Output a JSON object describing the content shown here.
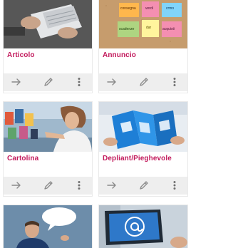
{
  "accent": "#c2185b",
  "cards": [
    {
      "title": "Articolo",
      "image": "hands-holding-newspaper-photo"
    },
    {
      "title": "Annuncio",
      "image": "sticky-notes-board-photo",
      "notes": [
        "consegna",
        "verdi",
        "crmo",
        "scadenze",
        "acquisti",
        "dar"
      ]
    },
    {
      "title": "Cartolina",
      "image": "woman-viewing-postcards-photo"
    },
    {
      "title": "Depliant/Pieghevole",
      "image": "folded-blue-brochure-photo"
    },
    {
      "title": "",
      "image": "man-with-speech-bubble-photo"
    },
    {
      "title": "",
      "image": "laptop-email-at-sign-photo"
    }
  ],
  "actions": {
    "open": "arrow-right-icon",
    "edit": "pencil-icon",
    "more": "more-vertical-icon"
  }
}
